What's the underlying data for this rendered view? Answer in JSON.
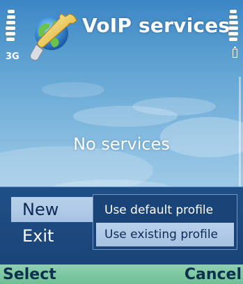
{
  "window": {
    "title": "VoIP services",
    "network_label": "3G"
  },
  "main": {
    "empty_text": "No services"
  },
  "options_menu": {
    "items": [
      {
        "label": "New",
        "selected": true
      },
      {
        "label": "Exit",
        "selected": false
      }
    ],
    "submenu": {
      "items": [
        {
          "label": "Use default profile",
          "selected": false
        },
        {
          "label": "Use existing profile",
          "selected": true
        }
      ]
    }
  },
  "softkeys": {
    "left": "Select",
    "right": "Cancel"
  },
  "icons": {
    "app": "globe-wrench-icon",
    "signal": "signal-strength-icon",
    "battery": "battery-level-icon"
  },
  "colors": {
    "menu_background": "#1f4f88",
    "selection_highlight": "#b8d0ea",
    "softkey_bar": "#8fd0b0",
    "softkey_text": "#0d2f4f"
  }
}
